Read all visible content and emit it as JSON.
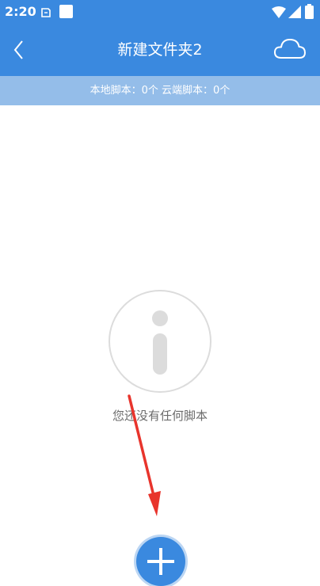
{
  "status_bar": {
    "time": "2:20"
  },
  "header": {
    "title": "新建文件夹2"
  },
  "summary": {
    "text": "本地脚本：0个 云端脚本：0个"
  },
  "empty_state": {
    "message": "您还没有任何脚本"
  },
  "icons": {
    "back": "chevron-left-icon",
    "cloud": "cloud-icon",
    "info": "info-icon",
    "add": "plus-icon"
  },
  "colors": {
    "primary": "#3a89df",
    "info_bar": "#94bde9",
    "annotation_arrow": "#e8342c"
  }
}
